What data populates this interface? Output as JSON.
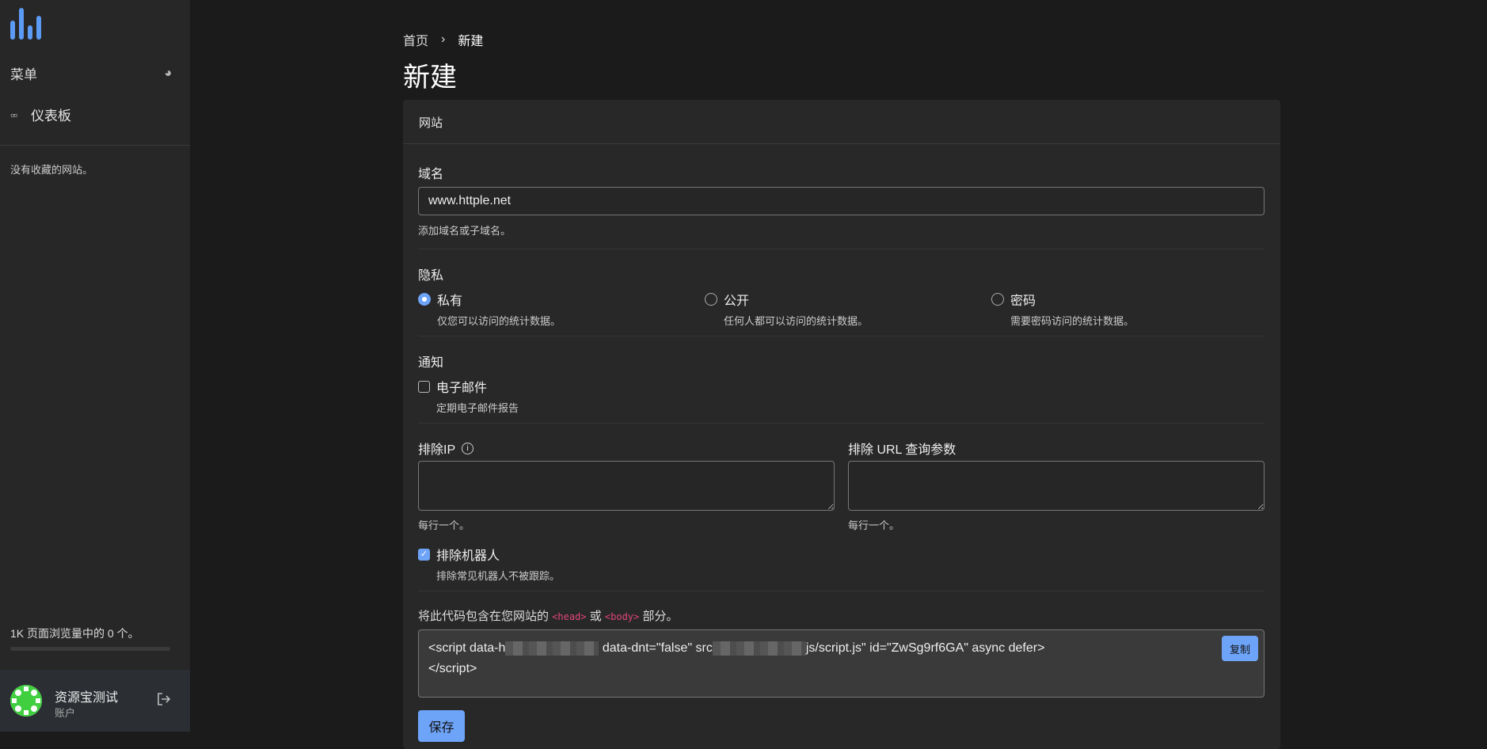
{
  "sidebar": {
    "menu_label": "菜单",
    "dashboard": "仪表板",
    "no_favorites": "没有收藏的网站。",
    "usage": "1K 页面浏览量中的 0 个。",
    "usage_fraction": 0,
    "user_name": "资源宝测试",
    "user_role": "账户"
  },
  "breadcrumb": {
    "home": "首页",
    "current": "新建"
  },
  "page_title": "新建",
  "card": {
    "header": "网站",
    "domain": {
      "label": "域名",
      "value": "www.httple.net",
      "hint": "添加域名或子域名。"
    },
    "privacy": {
      "label": "隐私",
      "options": [
        {
          "label": "私有",
          "desc": "仅您可以访问的统计数据。",
          "selected": true
        },
        {
          "label": "公开",
          "desc": "任何人都可以访问的统计数据。",
          "selected": false
        },
        {
          "label": "密码",
          "desc": "需要密码访问的统计数据。",
          "selected": false
        }
      ]
    },
    "notify": {
      "label": "通知",
      "email_label": "电子邮件",
      "email_desc": "定期电子邮件报告",
      "checked": false
    },
    "exclude_ip": {
      "label": "排除IP",
      "hint": "每行一个。"
    },
    "exclude_url": {
      "label": "排除 URL 查询参数",
      "hint": "每行一个。"
    },
    "bots": {
      "label": "排除机器人",
      "desc": "排除常见机器人不被跟踪。",
      "checked": true
    },
    "code": {
      "intro_pre": "将此代码包含在您网站的",
      "head": "<head>",
      "or": "或",
      "body": "<body>",
      "intro_post": "部分。",
      "part1": "<script data-h",
      "part2": "data-dnt=\"false\" src",
      "part3": "js/script.js\" id=\"ZwSg9rf6GA\" async defer>",
      "line2": "</script>",
      "copy": "复制"
    },
    "save": "保存"
  },
  "colors": {
    "accent": "#6ea4f8"
  }
}
